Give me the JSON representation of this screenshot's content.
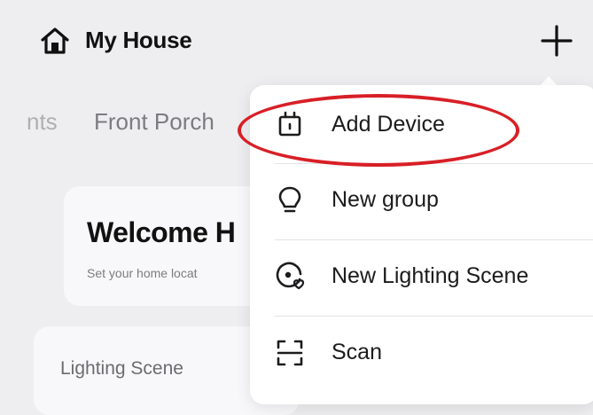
{
  "header": {
    "title": "My House",
    "home_icon": "home-icon",
    "add_icon": "plus-icon"
  },
  "tabs": [
    {
      "label": "nts"
    },
    {
      "label": "Front Porch"
    }
  ],
  "welcome_card": {
    "title": "Welcome H",
    "subtitle": "Set your home locat"
  },
  "scene_card": {
    "title": "Lighting Scene"
  },
  "menu": {
    "items": [
      {
        "label": "Add Device",
        "icon": "add-device-icon"
      },
      {
        "label": "New group",
        "icon": "lightbulb-icon"
      },
      {
        "label": "New Lighting Scene",
        "icon": "lighting-scene-icon"
      },
      {
        "label": "Scan",
        "icon": "scan-icon"
      }
    ]
  },
  "colors": {
    "background": "#eeeef0",
    "menu_bg": "#ffffff",
    "highlight": "#d81f26",
    "tab_text": "#7c7c80"
  }
}
